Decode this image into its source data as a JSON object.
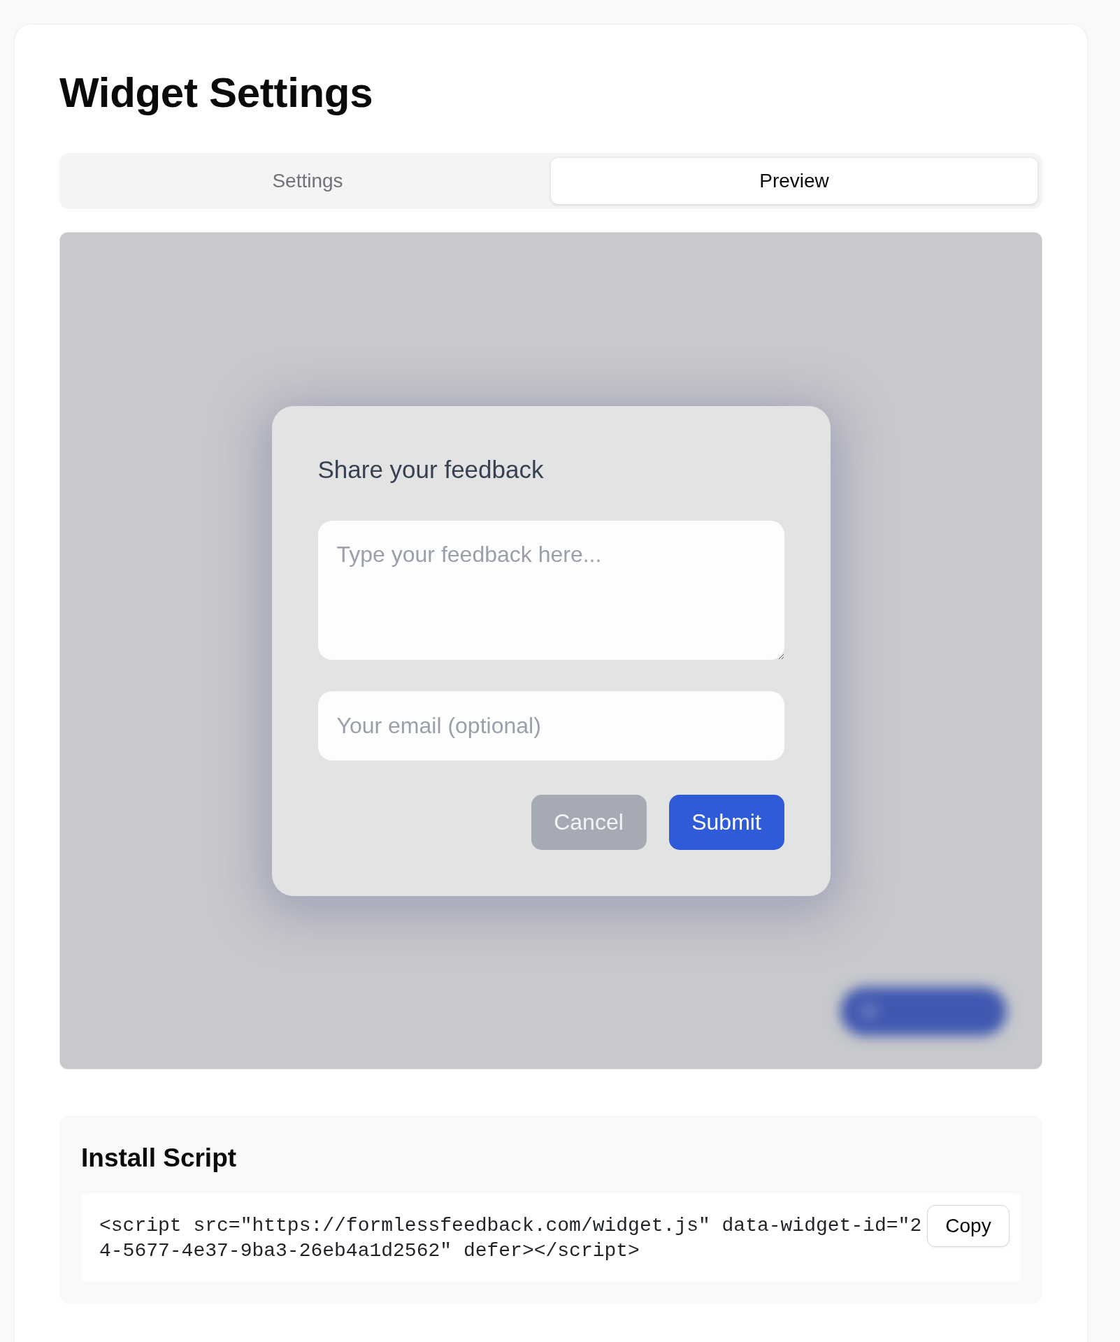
{
  "page": {
    "title": "Widget Settings"
  },
  "tabs": [
    {
      "label": "Settings",
      "selected": false
    },
    {
      "label": "Preview",
      "selected": true
    }
  ],
  "preview": {
    "dialog": {
      "title": "Share your feedback",
      "feedback_field": {
        "placeholder": "Type your feedback here..."
      },
      "email_field": {
        "placeholder": "Your email (optional)"
      },
      "buttons": [
        {
          "label": "Cancel",
          "kind": "secondary"
        },
        {
          "label": "Submit",
          "kind": "primary"
        }
      ]
    }
  },
  "install_script": {
    "title": "Install Script",
    "code_lines": [
      "<script src=\"https://formlessfeedback.com/widget.js\" data-widget-id=\"2",
      "4-5677-4e37-9ba3-26eb4a1d2562\" defer></script>"
    ],
    "copy_button": {
      "label": "Copy"
    }
  }
}
